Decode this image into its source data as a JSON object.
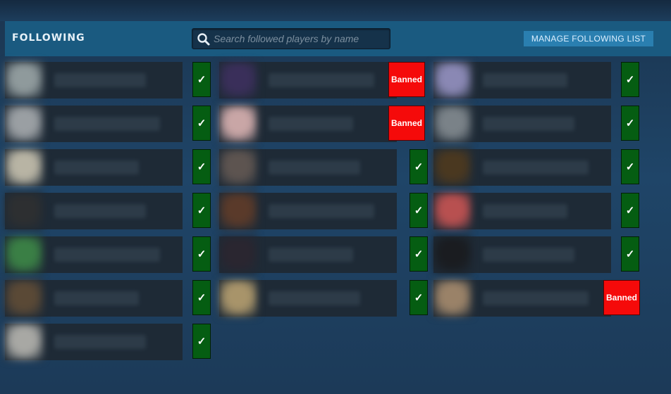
{
  "header": {
    "title": "FOLLOWING",
    "search_placeholder": "Search followed players by name",
    "search_value": "",
    "manage_label": "MANAGE FOLLOWING LIST"
  },
  "status_labels": {
    "ok": "✓",
    "banned": "Banned"
  },
  "columns": [
    [
      {
        "avatar_color": "#8f9a9c",
        "status": "ok"
      },
      {
        "avatar_color": "#9a9fa3",
        "status": "ok"
      },
      {
        "avatar_color": "#b8b4a4",
        "status": "ok"
      },
      {
        "avatar_color": "#2d2f31",
        "status": "ok"
      },
      {
        "avatar_color": "#3a7f45",
        "status": "ok"
      },
      {
        "avatar_color": "#5a4936",
        "status": "ok"
      },
      {
        "avatar_color": "#a8a8a4",
        "status": "ok"
      }
    ],
    [
      {
        "avatar_color": "#3a2f5a",
        "status": "banned"
      },
      {
        "avatar_color": "#c9a6a6",
        "status": "banned"
      },
      {
        "avatar_color": "#5d5450",
        "status": "ok"
      },
      {
        "avatar_color": "#5a3a2a",
        "status": "ok"
      },
      {
        "avatar_color": "#2a2630",
        "status": "ok"
      },
      {
        "avatar_color": "#a8946a",
        "status": "ok"
      }
    ],
    [
      {
        "avatar_color": "#8a88b4",
        "status": "ok"
      },
      {
        "avatar_color": "#7a8288",
        "status": "ok"
      },
      {
        "avatar_color": "#4a3820",
        "status": "ok"
      },
      {
        "avatar_color": "#b85050",
        "status": "ok"
      },
      {
        "avatar_color": "#1a1c20",
        "status": "ok"
      },
      {
        "avatar_color": "#9a8268",
        "status": "banned"
      }
    ]
  ]
}
